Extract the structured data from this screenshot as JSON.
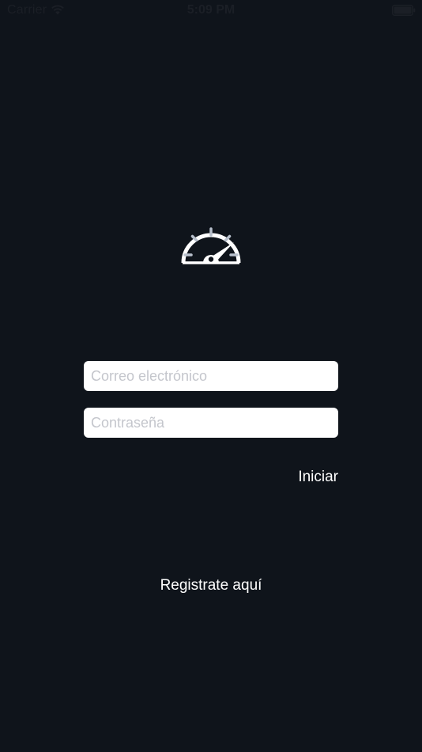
{
  "status_bar": {
    "carrier": "Carrier",
    "time": "5:09 PM",
    "wifi_icon": "wifi-icon",
    "battery_icon": "battery-icon"
  },
  "logo": {
    "icon": "speedometer-icon"
  },
  "form": {
    "email": {
      "value": "",
      "placeholder": "Correo electrónico"
    },
    "password": {
      "value": "",
      "placeholder": "Contraseña"
    },
    "login_label": "Iniciar"
  },
  "register_label": "Registrate aquí",
  "colors": {
    "background": "#0f141b",
    "text": "#ffffff",
    "input_background": "#ffffff",
    "placeholder": "#c4c6cc"
  }
}
